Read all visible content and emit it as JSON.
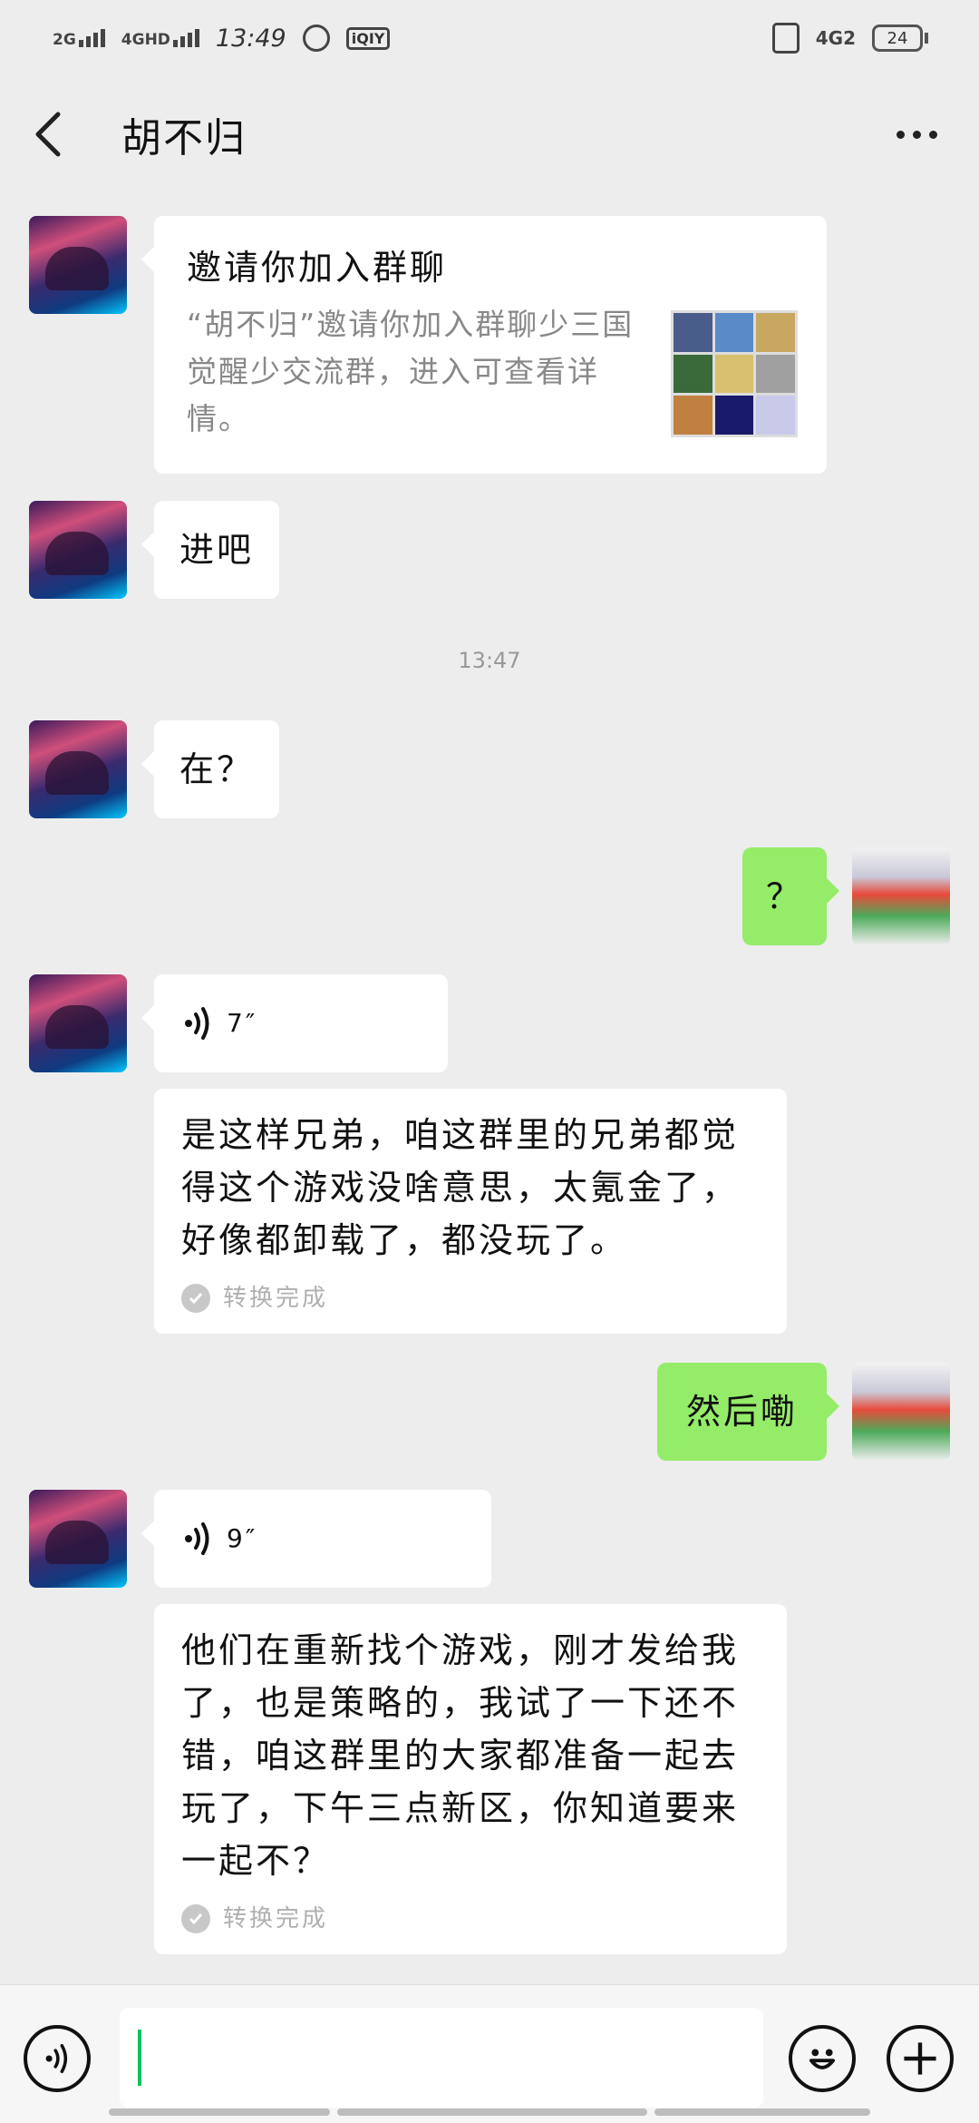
{
  "status_bar": {
    "network1": "2G",
    "network2": "4GHD",
    "time": "13:49",
    "app_badge": "iQIY",
    "network_right": "4G2",
    "battery": "24"
  },
  "header": {
    "title": "胡不归"
  },
  "messages": [
    {
      "type": "invite",
      "title": "邀请你加入群聊",
      "desc": "“胡不归”邀请你加入群聊少三国觉醒少交流群，进入可查看详情。",
      "thumb_colors": [
        "#4a5c8a",
        "#5a8ac8",
        "#c8a860",
        "#3a6a3a",
        "#d8c070",
        "#a0a0a0",
        "#c08040",
        "#1a1a6a",
        "#c8c8e8"
      ]
    },
    {
      "type": "text",
      "from": "them",
      "text": "进吧"
    },
    {
      "type": "time",
      "text": "13:47"
    },
    {
      "type": "text",
      "from": "them",
      "text": "在？"
    },
    {
      "type": "text",
      "from": "me",
      "text": "？"
    },
    {
      "type": "voice",
      "from": "them",
      "duration": "7″"
    },
    {
      "type": "transcript",
      "text": "是这样兄弟，咱这群里的兄弟都觉得这个游戏没啥意思，太氪金了，好像都卸载了，都没玩了。",
      "status": "转换完成"
    },
    {
      "type": "text",
      "from": "me",
      "text": "然后嘞"
    },
    {
      "type": "voice",
      "from": "them",
      "duration": "9″"
    },
    {
      "type": "transcript",
      "text": "他们在重新找个游戏，刚才发给我了，也是策略的，我试了一下还不错，咱这群里的大家都准备一起去玩了，下午三点新区，你知道要来一起不？",
      "status": "转换完成"
    }
  ],
  "colors": {
    "background": "#ededed",
    "my_bubble": "#95ec69",
    "their_bubble": "#ffffff",
    "accent": "#07c160"
  },
  "icons": {
    "back": "back-arrow-icon",
    "more": "more-dots-icon",
    "voice_toggle": "voice-icon",
    "emoji": "emoji-icon",
    "add": "plus-icon"
  }
}
